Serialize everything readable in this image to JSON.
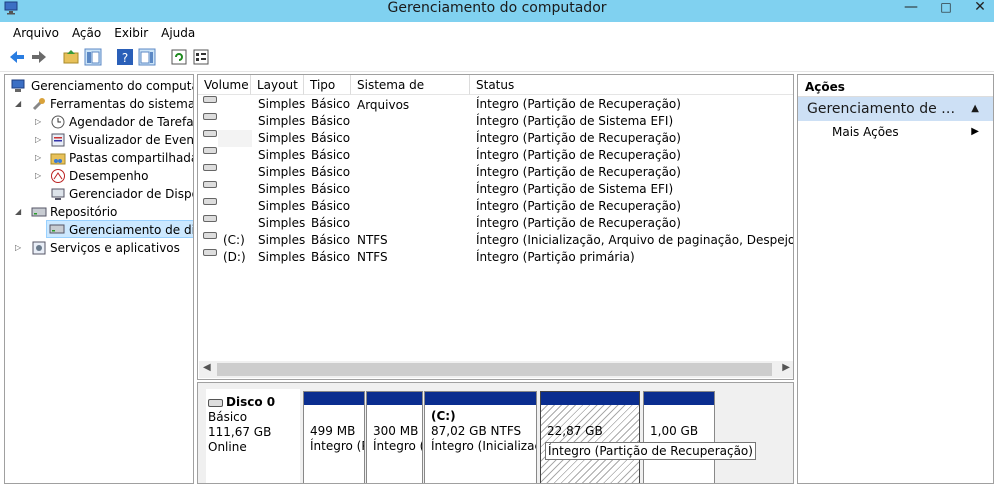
{
  "window": {
    "title": "Gerenciamento do computador"
  },
  "menu": [
    "Arquivo",
    "Ação",
    "Exibir",
    "Ajuda"
  ],
  "tree": {
    "root": "Gerenciamento do computador (Local)",
    "system_tools": "Ferramentas do sistema",
    "task_scheduler": "Agendador de Tarefas",
    "event_viewer": "Visualizador de Eventos",
    "shared_folders": "Pastas compartilhadas",
    "performance": "Desempenho",
    "device_manager": "Gerenciador de Dispositivos",
    "storage": "Repositório",
    "disk_management": "Gerenciamento de disco",
    "services": "Serviços e aplicativos"
  },
  "volumes": {
    "headers": [
      "Volume",
      "Layout",
      "Tipo",
      "Sistema de Arquivos",
      "Status"
    ],
    "rows": [
      {
        "volume": "",
        "layout": "Simples",
        "type": "Básico",
        "fs": "",
        "status": "Íntegro (Partição de Recuperação)"
      },
      {
        "volume": "",
        "layout": "Simples",
        "type": "Básico",
        "fs": "",
        "status": "Íntegro (Partição de Sistema EFI)"
      },
      {
        "volume": "",
        "layout": "Simples",
        "type": "Básico",
        "fs": "",
        "status": "Íntegro (Partição de Recuperação)"
      },
      {
        "volume": "",
        "layout": "Simples",
        "type": "Básico",
        "fs": "",
        "status": "Íntegro (Partição de Recuperação)"
      },
      {
        "volume": "",
        "layout": "Simples",
        "type": "Básico",
        "fs": "",
        "status": "Íntegro (Partição de Recuperação)"
      },
      {
        "volume": "",
        "layout": "Simples",
        "type": "Básico",
        "fs": "",
        "status": "Íntegro (Partição de Sistema EFI)"
      },
      {
        "volume": "",
        "layout": "Simples",
        "type": "Básico",
        "fs": "",
        "status": "Íntegro (Partição de Recuperação)"
      },
      {
        "volume": "",
        "layout": "Simples",
        "type": "Básico",
        "fs": "",
        "status": "Íntegro (Partição de Recuperação)"
      },
      {
        "volume": "(C:)",
        "layout": "Simples",
        "type": "Básico",
        "fs": "NTFS",
        "status": "Íntegro (Inicialização, Arquivo de paginação, Despejo de memória, Partição primária)"
      },
      {
        "volume": "(D:)",
        "layout": "Simples",
        "type": "Básico",
        "fs": "NTFS",
        "status": "Íntegro (Partição primária)"
      }
    ]
  },
  "disk": {
    "name": "Disco 0",
    "type": "Básico",
    "size": "111,67 GB",
    "state": "Online",
    "partitions": [
      {
        "label": "",
        "size": "499 MB",
        "status": "Íntegro (Partição de Recuperação)"
      },
      {
        "label": "",
        "size": "300 MB",
        "status": "Íntegro (Partição de Sistema EFI)"
      },
      {
        "label": "(C:)",
        "size": "87,02 GB NTFS",
        "status": "Íntegro (Inicialização, Arquivo de paginação...)"
      },
      {
        "label": "",
        "size": "22,87 GB",
        "status": "Íntegro (Partição de Recuperação)"
      },
      {
        "label": "",
        "size": "1,00 GB",
        "status": "Íntegro (Partição de Recuperação)"
      }
    ],
    "tooltip": "Íntegro (Partição de Recuperação)"
  },
  "actions": {
    "header": "Ações",
    "section": "Gerenciamento de disco",
    "more": "Mais Ações"
  }
}
